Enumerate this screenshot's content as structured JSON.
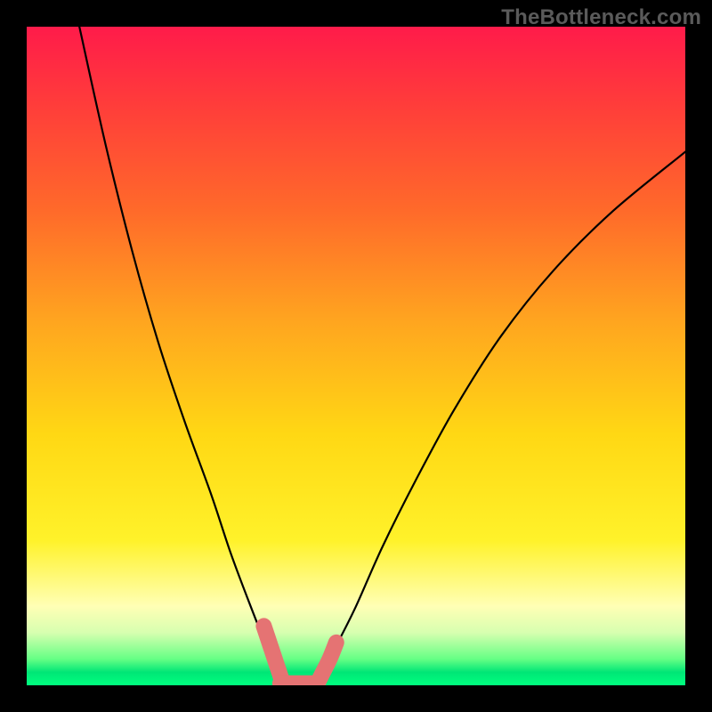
{
  "watermark": "TheBottleneck.com",
  "chart_data": {
    "type": "line",
    "title": "",
    "xlabel": "",
    "ylabel": "",
    "xlim": [
      0,
      100
    ],
    "ylim": [
      0,
      100
    ],
    "grid": false,
    "legend": false,
    "series": [
      {
        "name": "left-curve",
        "x": [
          8,
          12,
          16,
          20,
          24,
          28,
          31,
          34,
          36,
          37.5,
          38.5,
          39
        ],
        "y": [
          100,
          82,
          66,
          52,
          40,
          29,
          20,
          12,
          7,
          4,
          2,
          0
        ]
      },
      {
        "name": "right-curve",
        "x": [
          44,
          45,
          47,
          50,
          54,
          59,
          65,
          72,
          80,
          89,
          100
        ],
        "y": [
          0,
          2,
          6,
          12,
          21,
          31,
          42,
          53,
          63,
          72,
          81
        ]
      }
    ],
    "highlight_segments": [
      {
        "name": "left-marker",
        "x": [
          36,
          37,
          38,
          38.5,
          39
        ],
        "y": [
          9,
          6,
          3,
          1.5,
          0
        ]
      },
      {
        "name": "valley-floor",
        "x": [
          38.5,
          40,
          42,
          44
        ],
        "y": [
          0.3,
          0.3,
          0.3,
          0.3
        ]
      },
      {
        "name": "right-marker",
        "x": [
          44,
          45,
          46,
          47
        ],
        "y": [
          0,
          2,
          4,
          6.5
        ]
      }
    ],
    "gradient_stops": [
      {
        "pos": 0.0,
        "color": "#ff1b4a"
      },
      {
        "pos": 0.12,
        "color": "#ff3d3a"
      },
      {
        "pos": 0.28,
        "color": "#ff6a2a"
      },
      {
        "pos": 0.45,
        "color": "#ffa61f"
      },
      {
        "pos": 0.62,
        "color": "#ffd814"
      },
      {
        "pos": 0.78,
        "color": "#fff22a"
      },
      {
        "pos": 0.88,
        "color": "#ffffb5"
      },
      {
        "pos": 0.92,
        "color": "#d7ffb0"
      },
      {
        "pos": 0.96,
        "color": "#66ff85"
      },
      {
        "pos": 0.98,
        "color": "#00e676"
      },
      {
        "pos": 1.0,
        "color": "#00ff7f"
      }
    ],
    "colors": {
      "curve": "#000000",
      "highlight": "#e57373",
      "frame": "#000000"
    }
  }
}
